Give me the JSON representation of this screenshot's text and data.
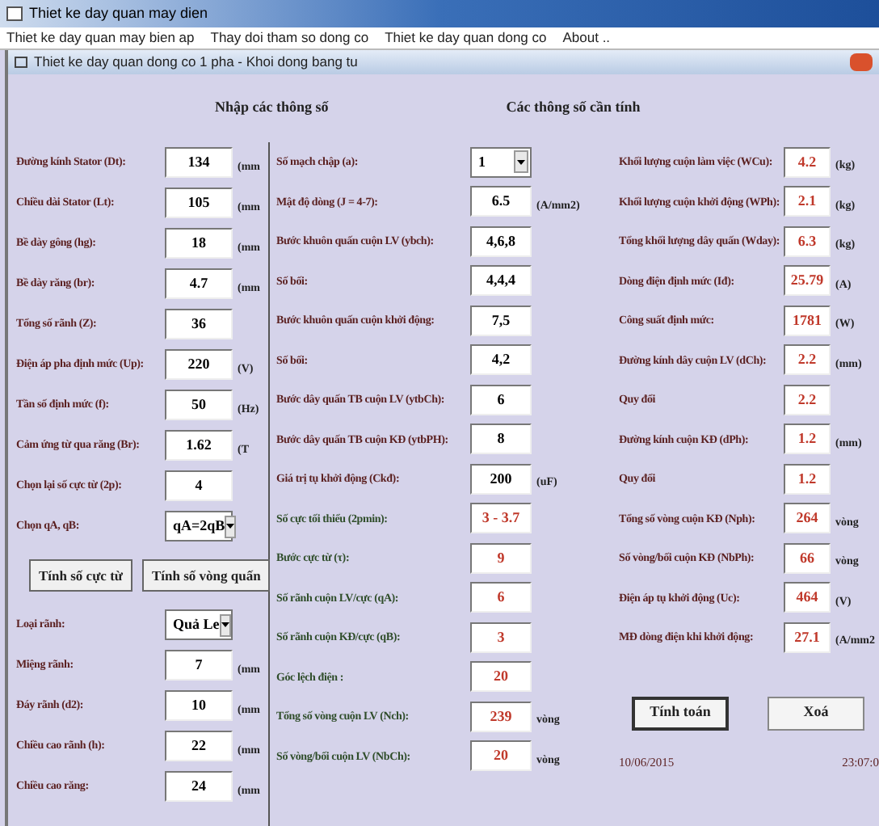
{
  "window": {
    "title": "Thiet ke day quan may dien"
  },
  "menu": [
    "Thiet ke day quan may bien ap",
    "Thay doi tham so dong co",
    "Thiet ke day quan dong co",
    "About .."
  ],
  "child_window": {
    "title": "Thiet ke day quan dong co 1 pha - Khoi dong bang tu"
  },
  "input_heading": "Nhập các thông số",
  "output_heading": "Các thông số cần tính",
  "left_fields": [
    {
      "kind": "input",
      "label": "Đường kính Stator (Dt):",
      "value": "134",
      "unit": "(mm"
    },
    {
      "kind": "input",
      "label": "Chiều dài Stator (Lt):",
      "value": "105",
      "unit": "(mm"
    },
    {
      "kind": "input",
      "label": "Bề dày gông (hg):",
      "value": "18",
      "unit": "(mm"
    },
    {
      "kind": "input",
      "label": "Bề dày răng (br):",
      "value": "4.7",
      "unit": "(mm"
    },
    {
      "kind": "input",
      "label": "Tổng số rãnh (Z):",
      "value": "36"
    },
    {
      "kind": "input",
      "label": "Điện áp pha định mức (Up):",
      "value": "220",
      "unit": "(V)"
    },
    {
      "kind": "input",
      "label": "Tần số định mức (f):",
      "value": "50",
      "unit": "(Hz)"
    },
    {
      "kind": "input",
      "label": "Cảm ứng từ qua răng (Br):",
      "value": "1.62",
      "unit": "(T"
    },
    {
      "kind": "input",
      "label": "Chọn lại số cực từ (2p):",
      "value": "4"
    },
    {
      "kind": "combo",
      "label": "Chọn qA, qB:",
      "value": "qA=2qB"
    },
    {
      "kind": "buttons",
      "buttons": [
        "Tính số cực từ",
        "Tính số vòng quấn"
      ]
    },
    {
      "kind": "combo",
      "label": "Loại rãnh:",
      "value": "Quả Le"
    },
    {
      "kind": "input",
      "label": "Miệng rãnh:",
      "value": "7",
      "unit": "(mm"
    },
    {
      "kind": "input",
      "label": "Đáy rãnh (d2):",
      "value": "10",
      "unit": "(mm"
    },
    {
      "kind": "input",
      "label": "Chiều cao rãnh (h):",
      "value": "22",
      "unit": "(mm"
    },
    {
      "kind": "input",
      "label": "Chiều cao răng:",
      "value": "24",
      "unit": "(mm"
    }
  ],
  "middle_fields": [
    {
      "kind": "combo",
      "label": "Số mạch chập (a):",
      "value": "1",
      "output": false
    },
    {
      "kind": "input",
      "label": "Mật độ dòng (J = 4-7):",
      "value": "6.5",
      "unit": "(A/mm2)",
      "output": false
    },
    {
      "kind": "input",
      "label": "Bước khuôn quấn cuộn LV (ybch):",
      "value": "4,6,8",
      "output": false
    },
    {
      "kind": "input",
      "label": "Số bối:",
      "value": "4,4,4",
      "output": false
    },
    {
      "kind": "input",
      "label": "Bước khuôn quấn cuộn khởi động:",
      "value": "7,5",
      "output": false
    },
    {
      "kind": "input",
      "label": "Số bối:",
      "value": "4,2",
      "output": false
    },
    {
      "kind": "input",
      "label": "Bước dây quấn TB cuộn LV (ytbCh):",
      "value": "6",
      "output": false
    },
    {
      "kind": "input",
      "label": "Bước dây quấn TB cuộn KĐ (ytbPH):",
      "value": "8",
      "output": false
    },
    {
      "kind": "input",
      "label": "Giá trị tụ khởi động (Ckđ):",
      "value": "200",
      "unit": "(uF)",
      "output": false
    },
    {
      "kind": "input",
      "label": "Số cực tối thiểu (2pmin):",
      "value": "3 - 3.7",
      "output": true
    },
    {
      "kind": "input",
      "label": "Bước cực từ (τ):",
      "value": "9",
      "output": true
    },
    {
      "kind": "input",
      "label": "Số rãnh cuộn LV/cực (qA):",
      "value": "6",
      "output": true
    },
    {
      "kind": "input",
      "label": "Số rãnh cuộn KĐ/cực (qB):",
      "value": "3",
      "output": true
    },
    {
      "kind": "input",
      "label": "Góc lệch điện :",
      "value": "20",
      "output": true
    },
    {
      "kind": "input",
      "label": "Tổng số vòng cuộn LV (Nch):",
      "value": "239",
      "unit": "vòng",
      "output": true
    },
    {
      "kind": "input",
      "label": "Số vòng/bối cuộn LV (NbCh):",
      "value": "20",
      "unit": "vòng",
      "output": true
    }
  ],
  "right_fields": [
    {
      "label": "Khối lượng cuộn làm việc (WCu):",
      "value": "4.2",
      "unit": "(kg)"
    },
    {
      "label": "Khối lượng cuộn khởi động (WPh):",
      "value": "2.1",
      "unit": "(kg)"
    },
    {
      "label": "Tổng khối lượng dây quấn (Wday):",
      "value": "6.3",
      "unit": "(kg)"
    },
    {
      "label": "Dòng điện định mức (Iđ):",
      "value": "25.79",
      "unit": "(A)"
    },
    {
      "label": "Công suất định mức:",
      "value": "1781",
      "unit": "(W)"
    },
    {
      "label": "Đường kính dây cuộn LV (dCh):",
      "value": "2.2",
      "unit": "(mm)"
    },
    {
      "label": "Quy đổi",
      "value": "2.2"
    },
    {
      "label": "Đường kính cuộn KĐ (dPh):",
      "value": "1.2",
      "unit": "(mm)"
    },
    {
      "label": "Quy đổi",
      "value": "1.2"
    },
    {
      "label": "Tổng số vòng cuộn KĐ (Nph):",
      "value": "264",
      "unit": "vòng"
    },
    {
      "label": "Số vòng/bối cuộn KĐ (NbPh):",
      "value": "66",
      "unit": "vòng"
    },
    {
      "label": "Điện áp tụ khởi động (Uc):",
      "value": "464",
      "unit": "(V)"
    },
    {
      "label": "MĐ dòng điện khi khởi động:",
      "value": "27.1",
      "unit": "(A/mm2"
    }
  ],
  "actions": [
    "Tính toán",
    "Xoá"
  ],
  "status_bar": {
    "date": "10/06/2015",
    "time": "23:07:0"
  }
}
